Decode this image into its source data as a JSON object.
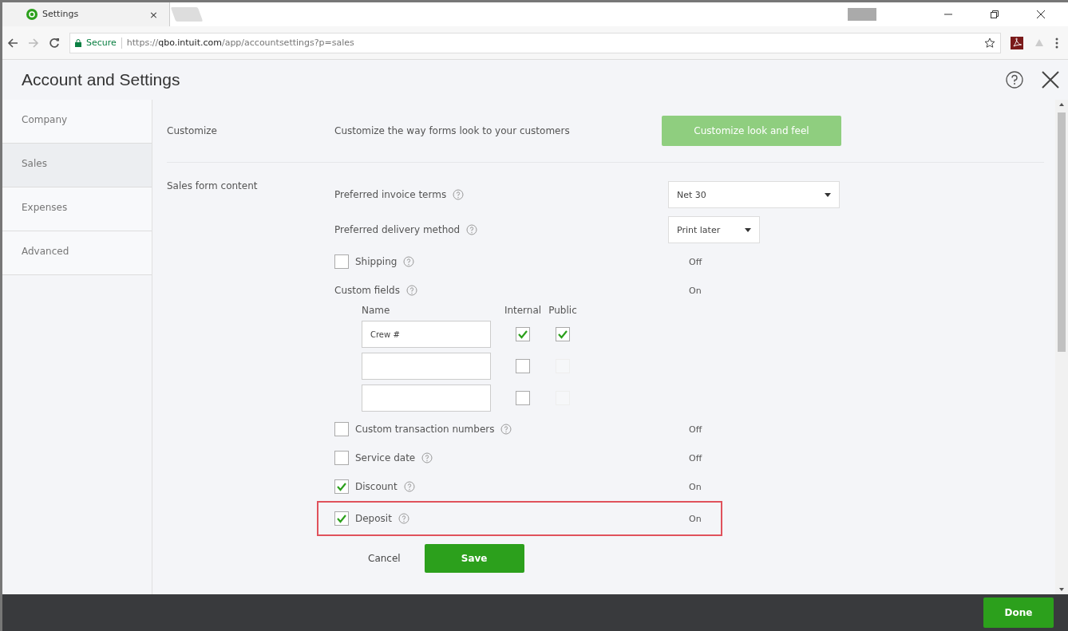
{
  "browser": {
    "tab_title": "Settings",
    "tab_close": "×",
    "secure_label": "Secure",
    "url_scheme": "https://",
    "url_host": "qbo.intuit.com",
    "url_path": "/app/accountsettings?p=sales"
  },
  "page": {
    "title": "Account and Settings"
  },
  "sidebar": {
    "items": [
      {
        "label": "Company",
        "selected": false
      },
      {
        "label": "Sales",
        "selected": true
      },
      {
        "label": "Expenses",
        "selected": false
      },
      {
        "label": "Advanced",
        "selected": false
      }
    ]
  },
  "customize": {
    "label": "Customize",
    "text": "Customize the way forms look to your customers",
    "button": "Customize look and feel"
  },
  "sales_form": {
    "label": "Sales form content",
    "rows": [
      {
        "kind": "wide_select",
        "label": "Preferred invoice terms",
        "value": "Net 30"
      },
      {
        "kind": "select",
        "label": "Preferred delivery method",
        "value": "Print later"
      },
      {
        "kind": "checkbox",
        "label": "Shipping",
        "checked": false,
        "status": "Off",
        "highlighted": false
      },
      {
        "kind": "info",
        "label": "Custom fields",
        "status": "On"
      },
      {
        "kind": "custom_fields",
        "headers": [
          "Name",
          "Internal",
          "Public"
        ],
        "fields": [
          {
            "value": "Crew #",
            "internal": true,
            "public": true,
            "public_disabled": false
          },
          {
            "internal": false,
            "public": false,
            "public_disabled": true
          },
          {
            "internal": false,
            "public": false,
            "public_disabled": true
          }
        ]
      },
      {
        "kind": "checkbox",
        "label": "Custom transaction numbers",
        "checked": false,
        "status": "Off",
        "highlighted": false
      },
      {
        "kind": "checkbox",
        "label": "Service date",
        "checked": false,
        "status": "Off",
        "highlighted": false
      },
      {
        "kind": "checkbox",
        "label": "Discount",
        "checked": true,
        "status": "On",
        "highlighted": false
      },
      {
        "kind": "checkbox",
        "label": "Deposit",
        "checked": true,
        "status": "On",
        "highlighted": true
      }
    ],
    "cancel": "Cancel",
    "save": "Save"
  },
  "footer": {
    "done": "Done"
  }
}
